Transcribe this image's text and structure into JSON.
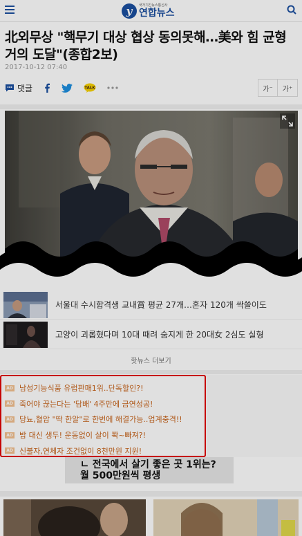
{
  "header": {
    "logo_sub": "국가기간뉴스통신사",
    "logo_name": "연합뉴스",
    "logo_mark": "y",
    "icons": [
      "hamburger-menu-icon",
      "search-icon"
    ]
  },
  "article": {
    "headline": "北외무상 \"핵무기 대상 협상 동의못해…美와 힘 균형 거의 도달\"(종합2보)",
    "date": "2017-10-12 07:40",
    "share": {
      "comment_label": "댓글",
      "talk_label": "TALK",
      "icons": [
        "comment-icon",
        "facebook-icon",
        "twitter-icon",
        "kakaotalk-icon",
        "more-icon"
      ]
    },
    "font_buttons": {
      "decrease": "가⁻",
      "increase": "가⁺"
    }
  },
  "hot_news": {
    "items": [
      {
        "title": "서울대 수시합격생 교내賞 평균 27개…혼자 120개 싹쓸이도"
      },
      {
        "title": "고양이 괴롭혔다며 10대 때려 숨지게 한 20대女 2심도 실형"
      }
    ],
    "more_label": "핫뉴스 더보기"
  },
  "ads": {
    "badge": "AD",
    "items": [
      "남성기능식품 유럽판매1위..단독할인?!",
      "죽어야 끊는다는 '담배' 4주만에 금연성공!",
      "당뇨,혈압 \"딱 한알\"로 한번에 해결가능..업계충격!!",
      "밥 대신 생두! 운동없이 살이 쫙~빠져?!",
      "신불자,연체자 조건없이 8천만원 지원!"
    ]
  },
  "banner": {
    "line1": "ㄴ 전국에서 살기 좋은 곳 1위는?",
    "line2": "월 500만원씩 평생"
  },
  "colors": {
    "brand_blue": "#1b4fa0",
    "ad_text": "#c8641b",
    "ad_badge": "#f3c08f",
    "ad_border": "#e20000"
  }
}
